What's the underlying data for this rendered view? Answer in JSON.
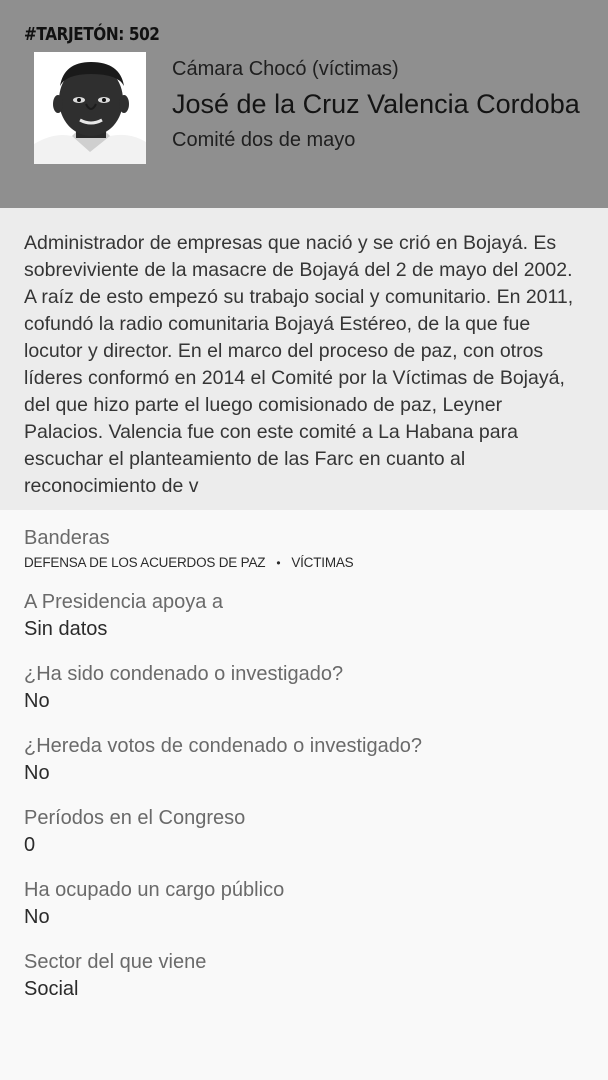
{
  "header": {
    "tarjeton": "#TARJETÓN: 502",
    "camara": "Cámara Chocó (víctimas)",
    "name": "José de la Cruz Valencia Cordoba",
    "comite": "Comité dos de mayo",
    "photo_icon": "candidate-portrait"
  },
  "bio": "Administrador de empresas que nació y se crió en Bojayá. Es sobreviviente de la masacre de Bojayá del 2 de mayo del 2002. A raíz de esto empezó su trabajo social y comunitario. En 2011, cofundó la radio comunitaria Bojayá Estéreo, de la que fue locutor y director. En el marco del proceso de paz, con otros líderes conformó en 2014 el Comité por la Víctimas de Bojayá, del que hizo parte el luego comisionado de paz, Leyner Palacios. Valencia fue con este comité a La Habana para escuchar el planteamiento de las Farc en cuanto al reconocimiento de v",
  "banderas": {
    "label": "Banderas",
    "tags": [
      "DEFENSA DE LOS ACUERDOS DE PAZ",
      "VÍCTIMAS"
    ],
    "separator": "•"
  },
  "fields": [
    {
      "label": "A Presidencia apoya a",
      "value": "Sin datos"
    },
    {
      "label": "¿Ha sido condenado o investigado?",
      "value": "No"
    },
    {
      "label": "¿Hereda votos de condenado o investigado?",
      "value": "No"
    },
    {
      "label": "Períodos en el Congreso",
      "value": "0"
    },
    {
      "label": "Ha ocupado un cargo público",
      "value": "No"
    },
    {
      "label": "Sector del que viene",
      "value": "Social"
    }
  ],
  "colors": {
    "header_bg": "#8f8f8f",
    "bio_bg": "#ececec",
    "page_bg": "#f9f9f9"
  }
}
